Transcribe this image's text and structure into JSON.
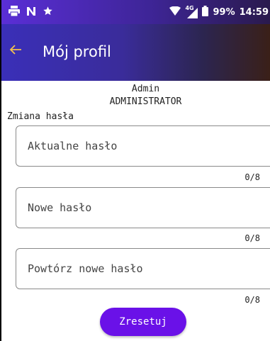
{
  "status_bar": {
    "left_icons": [
      "printer-icon",
      "n-icon",
      "star-icon"
    ],
    "network": "4G",
    "battery_percent": "99%",
    "time": "14:59"
  },
  "app_bar": {
    "title": "Mój profil"
  },
  "user": {
    "name": "Admin",
    "role": "ADMINISTRATOR"
  },
  "section_label": "Zmiana hasła",
  "fields": [
    {
      "placeholder": "Aktualne hasło",
      "value": "",
      "counter": "0/8"
    },
    {
      "placeholder": "Nowe hasło",
      "value": "",
      "counter": "0/8"
    },
    {
      "placeholder": "Powtórz nowe hasło",
      "value": "",
      "counter": "0/8"
    }
  ],
  "reset_button": {
    "label": "Zresetuj"
  },
  "colors": {
    "accent": "#6a11e8",
    "app_bar": "#3a2fb8",
    "back_arrow": "#f2c14e"
  }
}
